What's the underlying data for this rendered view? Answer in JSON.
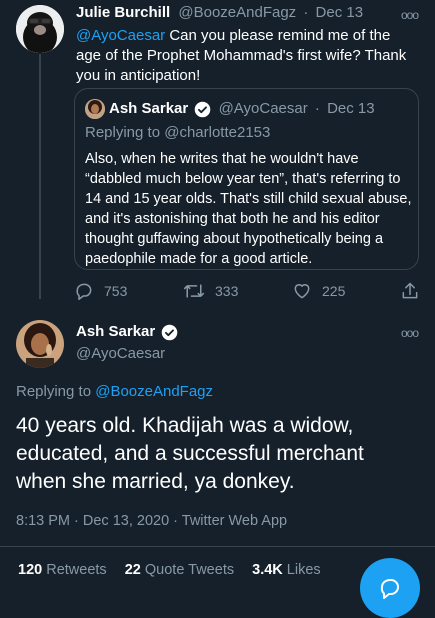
{
  "parent_tweet": {
    "author_name": "Julie Burchill",
    "handle": "@BoozeAndFagz",
    "separator": "·",
    "date": "Dec 13",
    "mention": "@AyoCaesar",
    "text": " Can you please remind me of the age of the Prophet Mohammad's first wife? Thank you in anticipation!",
    "quoted": {
      "author_name": "Ash Sarkar",
      "handle": "@AyoCaesar",
      "date": "Dec 13",
      "replying_prefix": "Replying to ",
      "replying_handle": "@charlotte2153",
      "text": "Also, when he writes that he wouldn't have “dabbled much below year ten”, that's referring to 14 and 15 year olds. That's still child sexual abuse, and it's astonishing that both he and his editor thought guffawing about hypothetically being a paedophile made for a good article."
    },
    "actions": {
      "replies": "753",
      "retweets": "333",
      "likes": "225"
    }
  },
  "main_tweet": {
    "author_name": "Ash Sarkar",
    "handle": "@AyoCaesar",
    "replying_prefix": "Replying to ",
    "replying_handle": "@BoozeAndFagz",
    "text": "40 years old. Khadijah was a widow, educated, and a successful merchant when she married, ya donkey.",
    "timestamp": "8:13 PM · Dec 13, 2020 · Twitter Web App",
    "stats": {
      "retweets_count": "120",
      "retweets_label": "Retweets",
      "quotes_count": "22",
      "quotes_label": "Quote Tweets",
      "likes_count": "3.4K",
      "likes_label": "Likes"
    }
  },
  "colors": {
    "background": "#15202b",
    "accent": "#1da1f2",
    "muted": "#8899a6",
    "border": "#38444d"
  },
  "icons": [
    "more-icon",
    "verified-icon",
    "reply-icon",
    "retweet-icon",
    "like-icon",
    "share-icon",
    "compose-icon"
  ]
}
